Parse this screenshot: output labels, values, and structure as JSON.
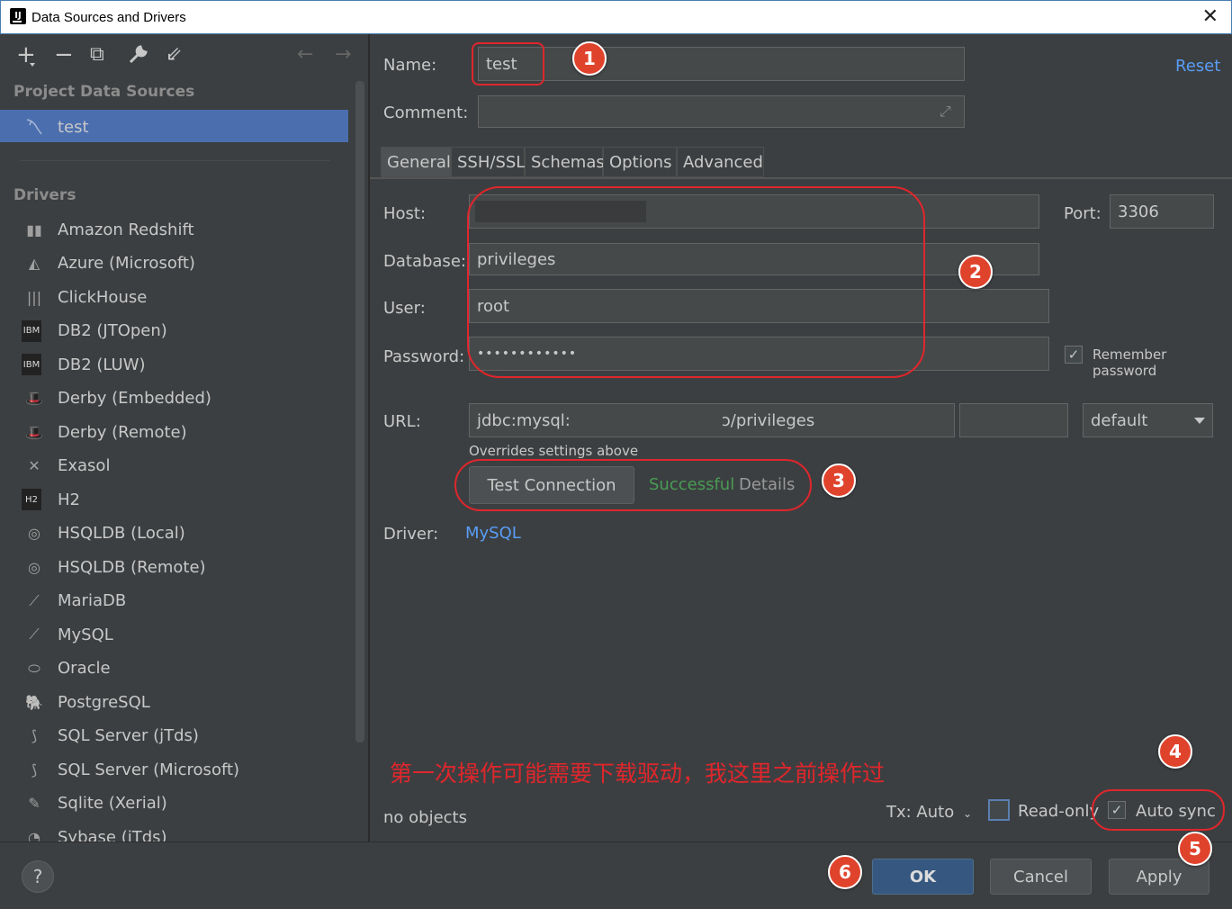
{
  "window": {
    "title": "Data Sources and Drivers",
    "close": "✕"
  },
  "toolbar": {
    "add": "+",
    "remove": "−",
    "copy": "⧉",
    "settings": "🔧",
    "import": "⇙",
    "back": "←",
    "forward": "→"
  },
  "left": {
    "project_title": "Project Data Sources",
    "selected": "test",
    "drivers_title": "Drivers",
    "drivers": [
      {
        "label": "Amazon Redshift",
        "icon": "redshift-icon"
      },
      {
        "label": "Azure (Microsoft)",
        "icon": "azure-icon"
      },
      {
        "label": "ClickHouse",
        "icon": "clickhouse-icon"
      },
      {
        "label": "DB2 (JTOpen)",
        "icon": "db2-icon"
      },
      {
        "label": "DB2 (LUW)",
        "icon": "db2-icon"
      },
      {
        "label": "Derby (Embedded)",
        "icon": "derby-icon"
      },
      {
        "label": "Derby (Remote)",
        "icon": "derby-icon"
      },
      {
        "label": "Exasol",
        "icon": "exasol-icon"
      },
      {
        "label": "H2",
        "icon": "h2-icon"
      },
      {
        "label": "HSQLDB (Local)",
        "icon": "hsqldb-icon"
      },
      {
        "label": "HSQLDB (Remote)",
        "icon": "hsqldb-icon"
      },
      {
        "label": "MariaDB",
        "icon": "mariadb-icon"
      },
      {
        "label": "MySQL",
        "icon": "mysql-icon"
      },
      {
        "label": "Oracle",
        "icon": "oracle-icon"
      },
      {
        "label": "PostgreSQL",
        "icon": "postgresql-icon"
      },
      {
        "label": "SQL Server (jTds)",
        "icon": "sqlserver-icon"
      },
      {
        "label": "SQL Server (Microsoft)",
        "icon": "sqlserver-icon"
      },
      {
        "label": "Sqlite (Xerial)",
        "icon": "sqlite-icon"
      },
      {
        "label": "Sybase (jTds)",
        "icon": "sybase-icon"
      }
    ]
  },
  "form": {
    "name_label": "Name:",
    "name_value": "test",
    "reset": "Reset",
    "comment_label": "Comment:",
    "tabs": [
      "General",
      "SSH/SSL",
      "Schemas",
      "Options",
      "Advanced"
    ],
    "host_label": "Host:",
    "host_value": "",
    "port_label": "Port:",
    "port_value": "3306",
    "database_label": "Database:",
    "database_value": "privileges",
    "user_label": "User:",
    "user_value": "root",
    "password_label": "Password:",
    "password_value": "••••••••••••",
    "remember_password": "Remember password",
    "url_label": "URL:",
    "url_value_left": "jdbc:mysql:",
    "url_value_right": "ɔ/privileges",
    "url_mode": "default",
    "overrides": "Overrides settings above",
    "test_connection": "Test Connection",
    "status": "Successful",
    "details": "Details",
    "driver_label": "Driver:",
    "driver_value": "MySQL",
    "note": "第一次操作可能需要下载驱动，我这里之前操作过",
    "no_objects": "no objects",
    "tx": "Tx: Auto",
    "readonly": "Read-only",
    "autosync": "Auto sync"
  },
  "badges": [
    "1",
    "2",
    "3",
    "4",
    "5",
    "6"
  ],
  "buttons": {
    "help": "?",
    "ok": "OK",
    "cancel": "Cancel",
    "apply": "Apply"
  },
  "colors": {
    "accent": "#4b6eaf",
    "success": "#499c54",
    "annotation": "#e0262c",
    "link": "#589df6"
  }
}
